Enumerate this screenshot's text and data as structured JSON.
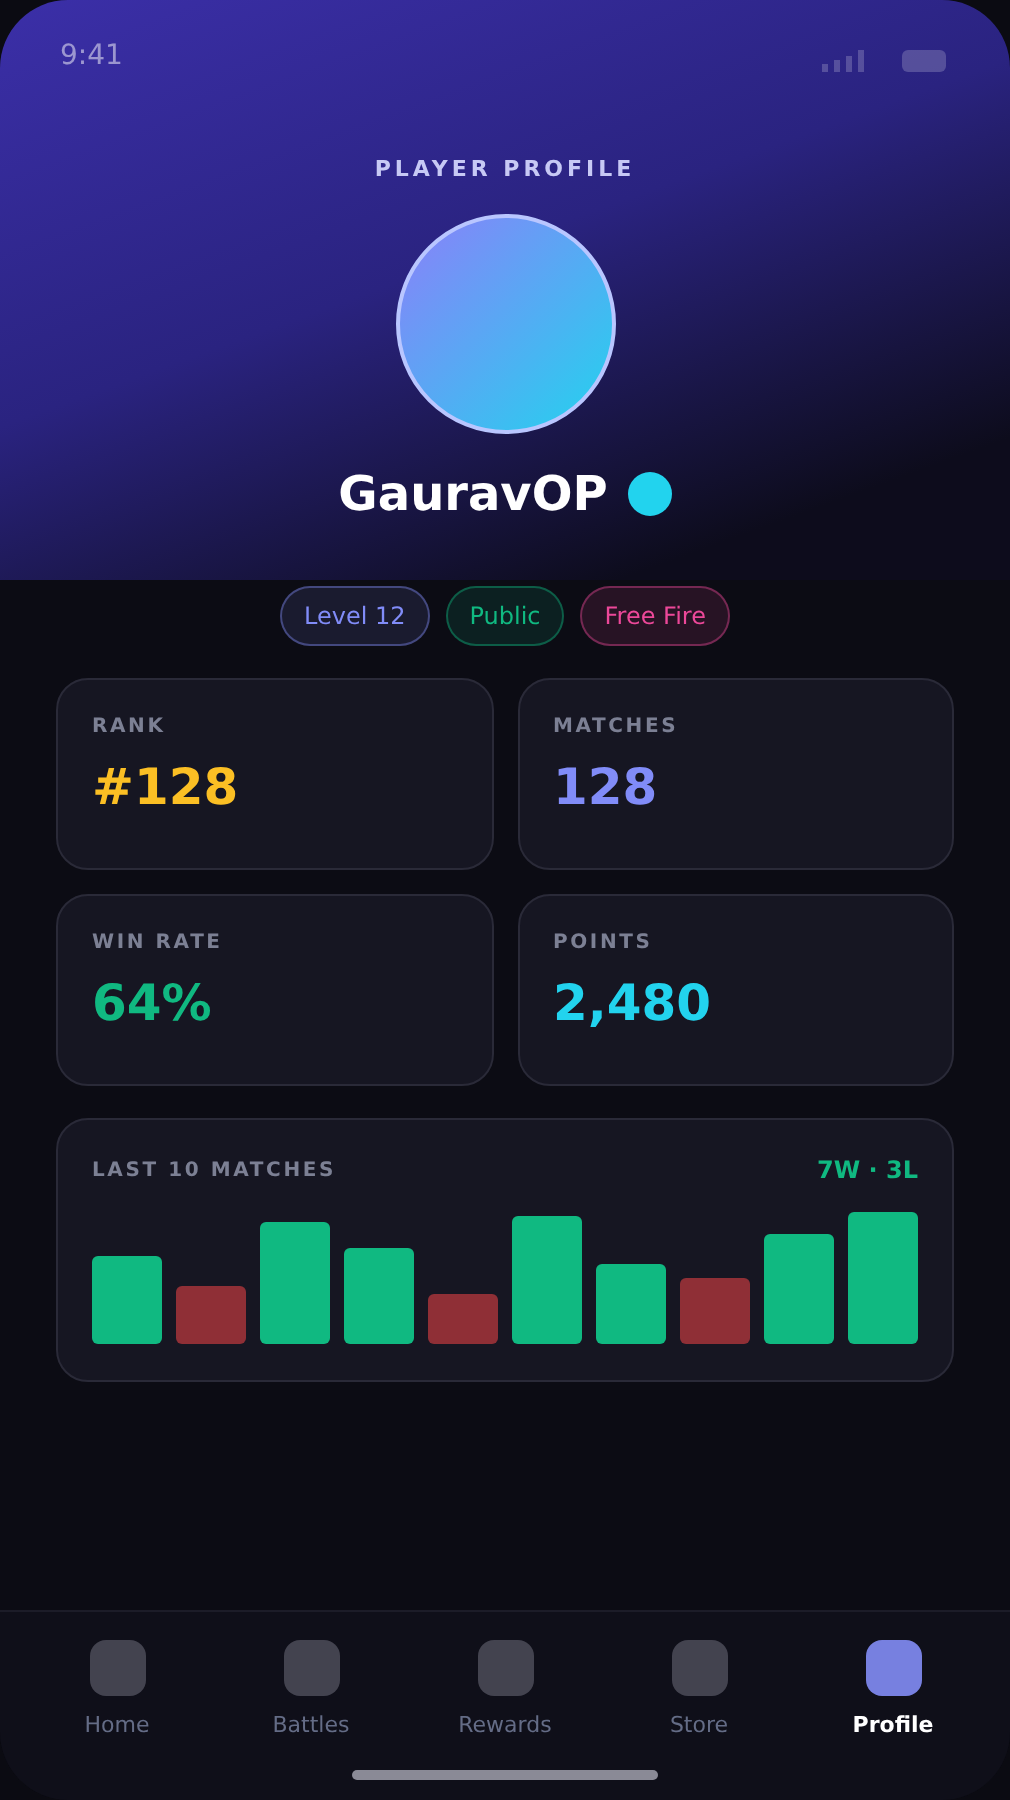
{
  "status_bar": {
    "time": "9:41"
  },
  "header": {
    "title": "PLAYER PROFILE",
    "username": "GauravOP",
    "online": true
  },
  "chips": [
    {
      "label": "Level 12",
      "color": "#818cf8"
    },
    {
      "label": "Public",
      "color": "#10b981"
    },
    {
      "label": "Free Fire",
      "color": "#ec4899"
    }
  ],
  "stats": [
    {
      "label": "RANK",
      "value": "#128",
      "color": "#fbbf24"
    },
    {
      "label": "MATCHES",
      "value": "128",
      "color": "#818cf8"
    },
    {
      "label": "WIN RATE",
      "value": "64%",
      "color": "#10b981"
    },
    {
      "label": "POINTS",
      "value": "2,480",
      "color": "#22d3ee"
    }
  ],
  "recent": {
    "title": "LAST 10 MATCHES",
    "summary": "7W · 3L",
    "matches": [
      {
        "kind": "win"
      },
      {
        "kind": "loss"
      },
      {
        "kind": "win"
      },
      {
        "kind": "win"
      },
      {
        "kind": "loss"
      },
      {
        "kind": "win"
      },
      {
        "kind": "win"
      },
      {
        "kind": "loss"
      },
      {
        "kind": "win"
      },
      {
        "kind": "win"
      }
    ]
  },
  "nav": [
    {
      "label": "Home",
      "selected": false
    },
    {
      "label": "Battles",
      "selected": false
    },
    {
      "label": "Rewards",
      "selected": false
    },
    {
      "label": "Store",
      "selected": false
    },
    {
      "label": "Profile",
      "selected": true
    }
  ]
}
